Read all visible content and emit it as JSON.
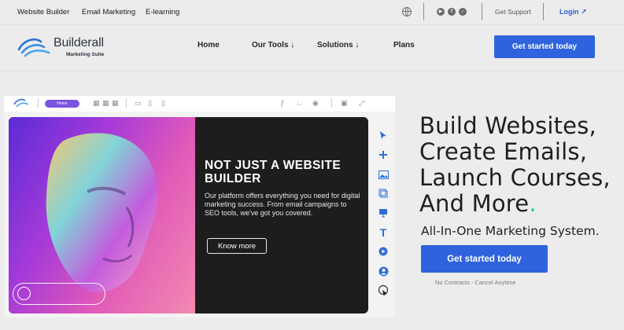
{
  "topbar": {
    "links": [
      "Website Builder",
      "Email Marketing",
      "E-learning"
    ],
    "support": "Get Support",
    "login": "Login ↗",
    "icons": [
      "globe-icon",
      "youtube-icon",
      "facebook-icon",
      "instagram-icon"
    ]
  },
  "nav": {
    "logo_name": "Builderall",
    "logo_sub": "Marketing Suite",
    "items": [
      "Home",
      "Our Tools ↓",
      "Solutions ↓",
      "Plans"
    ],
    "cta": "Get started today"
  },
  "editor": {
    "page_pill": "Home",
    "hero_title": "NOT JUST A WEBSITE BUILDER",
    "hero_body": "Our platform offers everything you need for digital marketing success. From email campaigns to SEO tools, we've got you covered.",
    "hero_button": "Know more"
  },
  "hero": {
    "headline": [
      "Build Websites,",
      "Create Emails,",
      "Launch Courses,",
      "And More"
    ],
    "headline_dot": ".",
    "subhead": "All-In-One Marketing System.",
    "cta": "Get started today",
    "note": "No Contracts - Cancel Anytime"
  },
  "colors": {
    "accent_blue": "#2f63dd",
    "teal_dot": "#22c3b3",
    "purple_pill": "#7b54e0"
  }
}
